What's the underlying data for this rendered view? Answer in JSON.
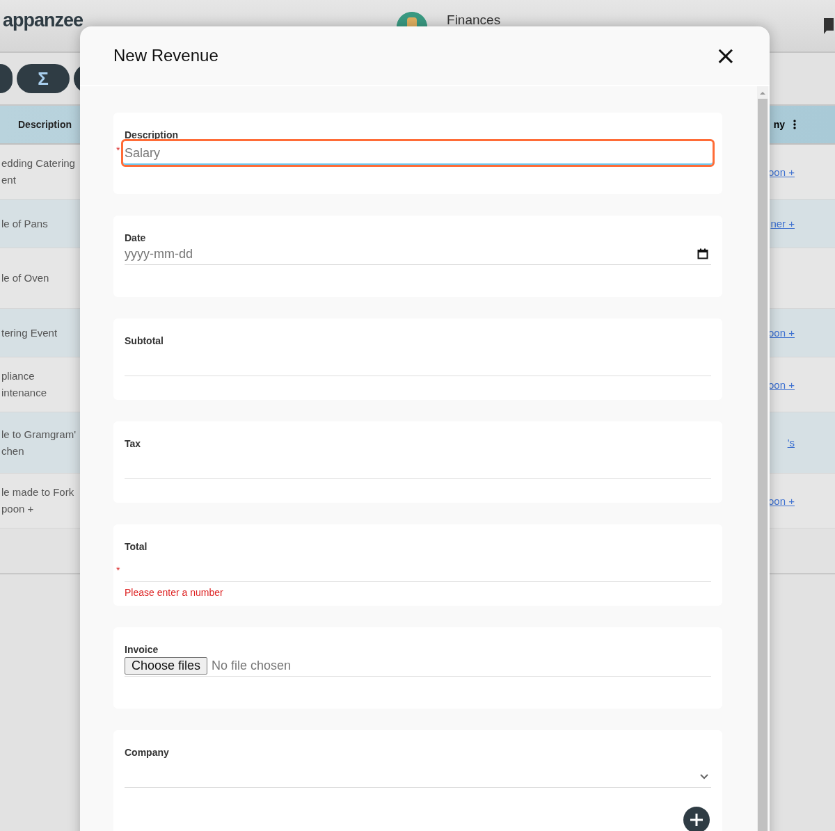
{
  "app": {
    "logo": "appanzee",
    "section_title": "Finances"
  },
  "toolbar": {
    "sum_button": "Σ"
  },
  "table": {
    "columns": [
      {
        "label": "Description"
      },
      {
        "label": "ny"
      }
    ],
    "rows": [
      {
        "description": [
          "edding Catering",
          "ent"
        ],
        "company": "oon +"
      },
      {
        "description": [
          "le of Pans"
        ],
        "company": "ner +"
      },
      {
        "description": [
          "le of Oven"
        ],
        "company": ""
      },
      {
        "description": [
          "tering Event"
        ],
        "company": "oon +"
      },
      {
        "description": [
          "pliance",
          "intenance"
        ],
        "company": "oon +"
      },
      {
        "description": [
          "le to Gramgram'",
          "chen"
        ],
        "company": "'s"
      },
      {
        "description": [
          "le made to Fork",
          "poon +"
        ],
        "company": "oon +"
      }
    ]
  },
  "dialog": {
    "title": "New Revenue",
    "close": "×",
    "fields": [
      {
        "kind": "text",
        "label": "Description",
        "required_mark": "*",
        "focused": true,
        "value": "Salary"
      },
      {
        "kind": "date",
        "label": "Date",
        "focused": false,
        "placeholder": "yyyy-mm-dd"
      },
      {
        "kind": "number",
        "label": "Subtotal",
        "focused": false
      },
      {
        "kind": "number",
        "label": "Tax",
        "focused": false
      },
      {
        "kind": "number",
        "label": "Total",
        "required_mark": "*",
        "focused": false,
        "error": "Please enter a number"
      },
      {
        "kind": "file",
        "label": "Invoice",
        "focused": false,
        "button": "Choose files",
        "status": "No file chosen"
      },
      {
        "kind": "select",
        "label": "Company",
        "focused": false
      }
    ]
  }
}
